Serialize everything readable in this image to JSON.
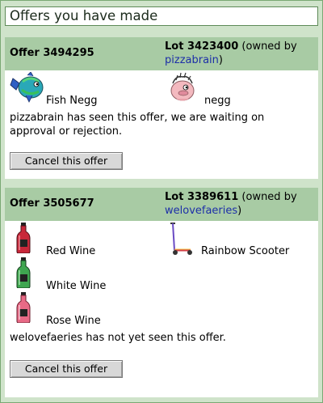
{
  "page": {
    "title": "Offers you have made"
  },
  "offers": [
    {
      "offer_id_text": "Offer 3494295",
      "lot_id_text": "Lot 3423400",
      "owned_prefix": " (owned by",
      "owner": "pizzabrain",
      "owned_suffix": ")",
      "offered_items": [
        {
          "name": "Fish Negg",
          "icon": "fish-negg-icon"
        }
      ],
      "lot_items": [
        {
          "name": "negg",
          "icon": "negg-icon"
        }
      ],
      "status": "pizzabrain has seen this offer, we are waiting on approval or rejection.",
      "cancel_label": "Cancel this offer"
    },
    {
      "offer_id_text": "Offer 3505677",
      "lot_id_text": "Lot 3389611",
      "owned_prefix": " (owned by",
      "owner": "welovefaeries",
      "owned_suffix": ")",
      "offered_items": [
        {
          "name": "Red Wine",
          "icon": "red-wine-bottle-icon",
          "color": "#c8283a"
        },
        {
          "name": "White Wine",
          "icon": "white-wine-bottle-icon",
          "color": "#3fa650"
        },
        {
          "name": "Rose Wine",
          "icon": "rose-wine-bottle-icon",
          "color": "#e86a86"
        }
      ],
      "lot_items": [
        {
          "name": "Rainbow Scooter",
          "icon": "rainbow-scooter-icon"
        }
      ],
      "status": "welovefaeries has not yet seen this offer.",
      "cancel_label": "Cancel this offer"
    }
  ]
}
